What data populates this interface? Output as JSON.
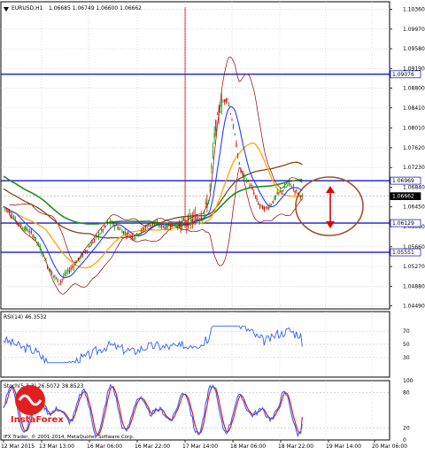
{
  "header": {
    "symbol": "EURUSD,H1",
    "ohlc": "1.06685 1.06749 1.06600 1.06662"
  },
  "colors": {
    "background": "#ffffff",
    "grid": "#c8c8c8",
    "frame": "#000000",
    "candle_up": "#00a000",
    "candle_down": "#e00000",
    "level_line": "#0000cc",
    "ma_fast": "#2040ff",
    "ma_slow": "#228b22",
    "ma_brown": "#8b4513",
    "ma_orange": "#ffa500",
    "bollinger": "#8b0000",
    "rsi_line": "#3060ff",
    "stoch_main": "#3060ff",
    "stoch_signal": "#e01010",
    "annotation": "#a0522d",
    "arrow": "#e00000"
  },
  "price_axis": {
    "ticks": [
      "1.10360",
      "1.09970",
      "1.09580",
      "1.09190",
      "1.08800",
      "1.08410",
      "1.08010",
      "1.07620",
      "1.07230",
      "1.06840",
      "1.06450",
      "1.06060",
      "1.05660",
      "1.05270",
      "1.04880",
      "1.04490"
    ],
    "level_labels": [
      "1.09076",
      "1.06969",
      "1.06662",
      "1.06129",
      "1.05551"
    ]
  },
  "rsi": {
    "label": "RSI(14) 46.3532",
    "ticks": [
      "70",
      "50",
      "30"
    ]
  },
  "stoch": {
    "label": "Stoch(5,3,3) 26.5072 38.8523",
    "ticks": [
      "100",
      "80",
      "20",
      "0"
    ]
  },
  "time_axis": {
    "labels": [
      "12 Mar 2015",
      "13 Mar 13:00",
      "16 Mar 06:00",
      "16 Mar 22:00",
      "17 Mar 14:00",
      "18 Mar 06:00",
      "18 Mar 22:00",
      "19 Mar 14:00",
      "20 Mar 06:00"
    ]
  },
  "watermark": {
    "brand": "InstaForex",
    "copyright": "IFX Trader, © 2001-2014, MetaQuotes Software Corp."
  },
  "chart_data": {
    "type": "candlestick",
    "title": "EURUSD,H1",
    "ohlc_current": {
      "open": 1.06685,
      "high": 1.06749,
      "low": 1.066,
      "close": 1.06662
    },
    "y_range": [
      1.0443,
      1.1051
    ],
    "horizontal_levels": [
      1.09076,
      1.06969,
      1.06129,
      1.05551
    ],
    "current_price": 1.06662,
    "close_path": [
      1.0645,
      1.0635,
      1.0618,
      1.0605,
      1.0598,
      1.0585,
      1.056,
      1.053,
      1.051,
      1.0495,
      1.0512,
      1.0525,
      1.054,
      1.0555,
      1.057,
      1.0585,
      1.06,
      1.0615,
      1.0608,
      1.0598,
      1.059,
      1.0585,
      1.0595,
      1.0608,
      1.0612,
      1.061,
      1.0605,
      1.061,
      1.0608,
      1.0612,
      1.0618,
      1.0622,
      1.063,
      1.066,
      1.08,
      1.085,
      1.086,
      1.08,
      1.072,
      1.07,
      1.068,
      1.065,
      1.064,
      1.065,
      1.067,
      1.068,
      1.069,
      1.0675,
      1.0666
    ],
    "rsi": {
      "value": 46.3532,
      "levels": [
        70,
        50,
        30
      ],
      "ylim": [
        0,
        100
      ]
    },
    "stochastic": {
      "main": 26.5072,
      "signal": 38.8523,
      "levels": [
        80,
        20
      ],
      "ylim": [
        0,
        100
      ]
    }
  }
}
